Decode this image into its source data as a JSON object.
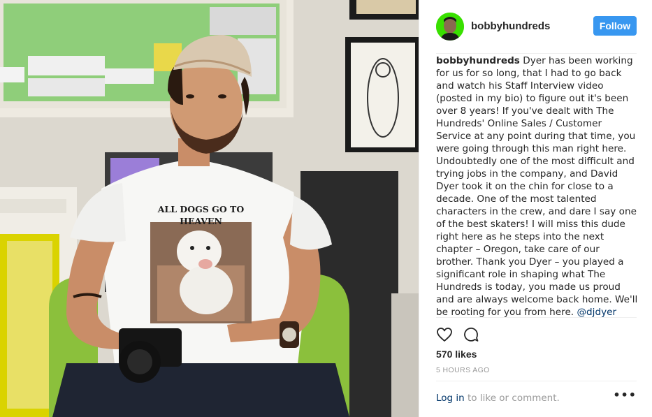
{
  "post": {
    "username": "bobbyhundreds",
    "follow_label": "Follow",
    "shirt_text_line1": "ALL DOGS GO TO",
    "shirt_text_line2": "HEAVEN",
    "caption_user": "bobbyhundreds",
    "caption_text": " Dyer has been working for us for so long, that I had to go back and watch his Staff Interview video (posted in my bio) to figure out it's been over 8 years! If you've dealt with The Hundreds' Online Sales / Customer Service at any point during that time, you were going through this man right here. Undoubtedly one of the most difficult and trying jobs in the company, and David Dyer took it on the chin for close to a decade. One of the most talented characters in the crew, and dare I say one of the best skaters! I will miss this dude right here as he steps into the next chapter – Oregon, take care of our brother. Thank you Dyer – you played a significant role in shaping what The Hundreds is today, you made us proud and are always welcome back home. We'll be rooting for you from here. ",
    "caption_mention": "@djdyer",
    "likes": "570 likes",
    "timestamp": "5 HOURS AGO",
    "footer_login": "Log in",
    "footer_rest": " to like or comment.",
    "more_label": "•••"
  },
  "icons": {
    "like": "heart-outline-icon",
    "comment": "speech-bubble-icon",
    "more": "ellipsis-icon"
  },
  "colors": {
    "follow_button": "#3897f0",
    "avatar_bg": "#39e000",
    "link": "#003569",
    "muted": "#999999"
  }
}
